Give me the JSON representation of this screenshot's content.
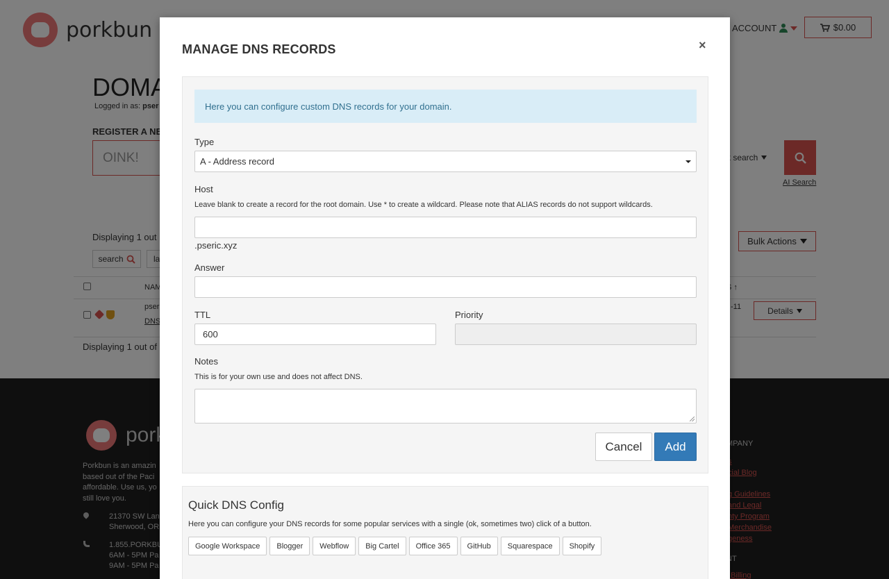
{
  "background": {
    "logo_text": "porkbun",
    "account_label": "ACCOUNT",
    "cart_total": "$0.00",
    "page_heading": "DOMA",
    "logged_in_prefix": "Logged in as: ",
    "logged_in_user": "pser",
    "register_label": "REGISTER A NEW",
    "search_placeholder": "OINK!",
    "bulk_search_label": "ılk search",
    "ai_search_link": "AI Search",
    "displaying_top": "Displaying 1 out",
    "bulk_actions_label": "Bulk Actions",
    "search_button_label": "search",
    "la_button_label": "la",
    "col_name": "NAM",
    "col_s": "S",
    "row_name": "pser",
    "row_dns_link": "DNS",
    "row_date": "-11",
    "details_label": "Details",
    "displaying_bottom": "Displaying 1 out of",
    "footer": {
      "logo_text": "pork",
      "about_lines": [
        "Porkbun is an amazin",
        "based out of the Paci",
        "affordable. Use us, yo",
        "still love you."
      ],
      "address_lines": [
        "21370 SW Lan",
        "Sherwood, OR"
      ],
      "phone_lines": [
        "1.855.PORKBU",
        "6AM - 5PM Pa",
        "9AM - 5PM Pa"
      ],
      "company_heading": "MPANY",
      "links": [
        "s",
        "cial Blog",
        "",
        "g Guidelines",
        "and Legal",
        "nty Program",
        "Merchandise",
        "geness"
      ],
      "nt_heading": "NT",
      "billing_link": "/ Billing"
    }
  },
  "modal": {
    "title": "MANAGE DNS RECORDS",
    "close_label": "×",
    "info_text": "Here you can configure custom DNS records for your domain.",
    "type_label": "Type",
    "type_value": "A - Address record",
    "host_label": "Host",
    "host_help": "Leave blank to create a record for the root domain. Use * to create a wildcard. Please note that ALIAS records do not support wildcards.",
    "host_value": "",
    "host_suffix": ".pseric.xyz",
    "answer_label": "Answer",
    "answer_value": "",
    "ttl_label": "TTL",
    "ttl_value": "600",
    "priority_label": "Priority",
    "priority_value": "",
    "notes_label": "Notes",
    "notes_help": "This is for your own use and does not affect DNS.",
    "cancel_label": "Cancel",
    "add_label": "Add",
    "quick": {
      "title": "Quick DNS Config",
      "description": "Here you can configure your DNS records for some popular services with a single (ok, sometimes two) click of a button.",
      "buttons": [
        "Google Workspace",
        "Blogger",
        "Webflow",
        "Big Cartel",
        "Office 365",
        "GitHub",
        "Squarespace",
        "Shopify"
      ]
    }
  },
  "colors": {
    "brand_red": "#d9534f",
    "primary_blue": "#337ab7",
    "info_bg": "#d9edf7",
    "info_text": "#31708f",
    "overlay": "rgba(0,0,0,0.5)"
  },
  "icons": [
    "pig-logo-icon",
    "user-icon",
    "caret-down-icon",
    "cart-icon",
    "search-icon",
    "tag-icon",
    "shield-icon",
    "map-pin-icon",
    "phone-icon",
    "close-icon",
    "resize-grip-icon"
  ]
}
